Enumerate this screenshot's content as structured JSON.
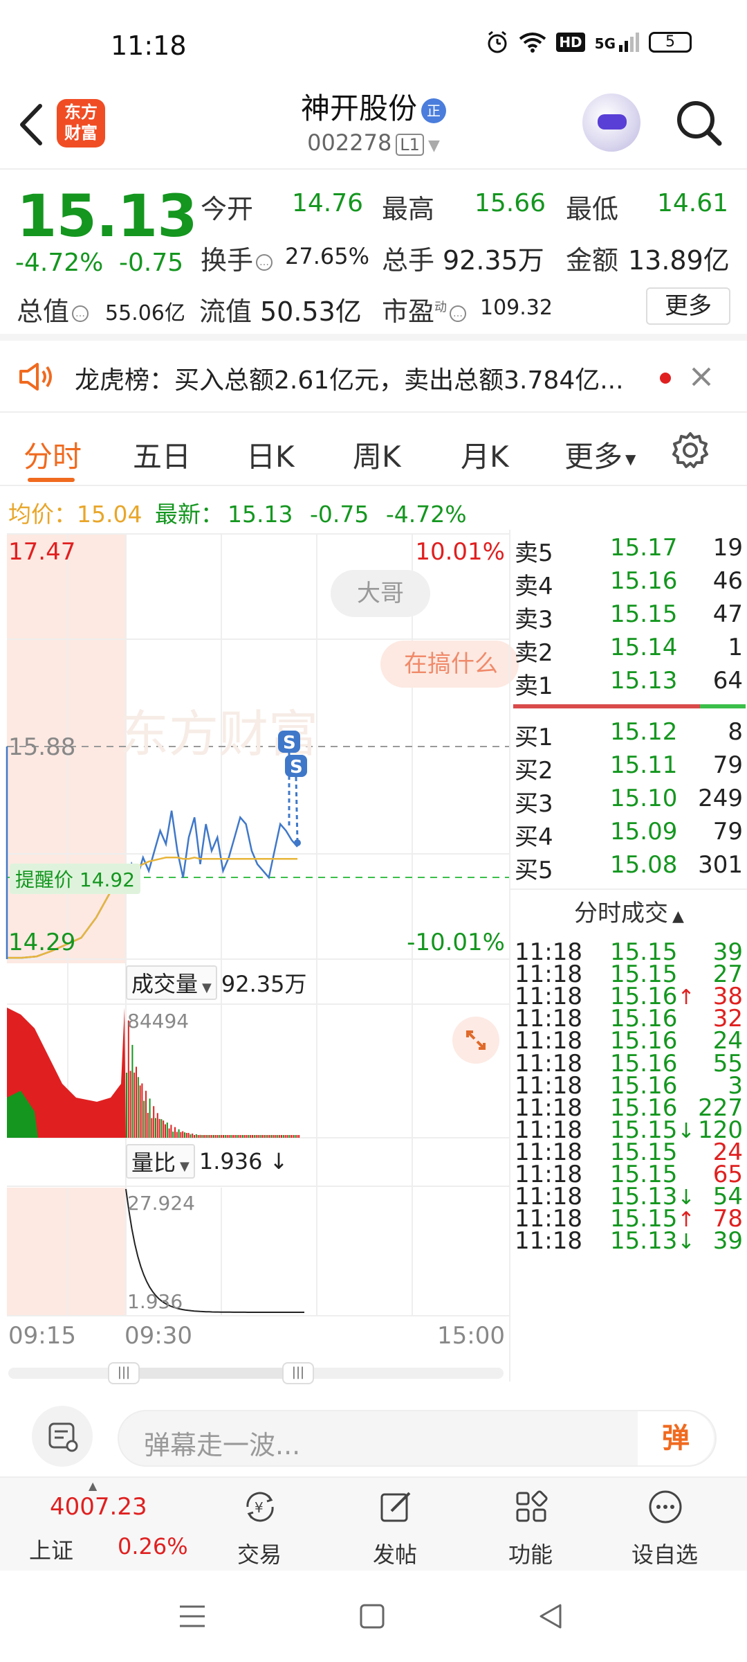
{
  "status_bar": {
    "time": "11:18",
    "hd": "HD",
    "net": "5G",
    "battery": "5"
  },
  "header": {
    "stock_name": "神开股份",
    "badge": "正",
    "stock_code": "002278",
    "level": "L1",
    "logo_line1": "东方",
    "logo_line2": "财富"
  },
  "quote": {
    "price": "15.13",
    "change_pct": "-4.72%",
    "change": "-0.75",
    "open_label": "今开",
    "open": "14.76",
    "high_label": "最高",
    "high": "15.66",
    "low_label": "最低",
    "low": "14.61",
    "turnover_label": "换手",
    "turnover": "27.65%",
    "volume_label": "总手",
    "volume": "92.35万",
    "amount_label": "金额",
    "amount": "13.89亿",
    "mktcap_label": "总值",
    "mktcap": "55.06亿",
    "float_label": "流值",
    "float_cap": "50.53亿",
    "pe_label": "市盈",
    "pe_sup": "动",
    "pe": "109.32",
    "more": "更多"
  },
  "notice": {
    "text": "龙虎榜：买入总额2.61亿元，卖出总额3.784亿..."
  },
  "tabs": [
    "分时",
    "五日",
    "日K",
    "周K",
    "月K",
    "更多"
  ],
  "avg_bar": {
    "avg_label": "均价：",
    "avg": "15.04",
    "latest_label": "最新：",
    "latest": "15.13",
    "change": "-0.75",
    "change_pct": "-4.72%"
  },
  "chart": {
    "y_top": "17.47",
    "y_top_pct": "10.01%",
    "y_mid": "15.88",
    "y_bottom": "14.29",
    "y_bottom_pct": "-10.01%",
    "alert_label": "提醒价 14.92",
    "watermark": "东方财富",
    "danmaku": [
      "大哥",
      "在搞什么"
    ],
    "s_marker": "S",
    "volume_label": "成交量",
    "volume_total": "92.35万",
    "volume_max": "84494",
    "ratio_label": "量比",
    "ratio_value": "1.936 ↓",
    "ratio_max": "27.924",
    "ratio_min": "1.936",
    "times": [
      "09:15",
      "09:30",
      "15:00"
    ],
    "colors": {
      "up": "#e02020",
      "down": "#14961f",
      "price_line": "#3f78c9",
      "avg_line": "#e8b53a"
    }
  },
  "chart_data": {
    "type": "line",
    "title": "",
    "x_range": [
      "09:15",
      "15:00"
    ],
    "ylim": [
      14.29,
      17.47
    ],
    "reference_price": 15.88,
    "alert_price": 14.92,
    "series": [
      {
        "values": [
          14.3,
          14.3,
          14.31,
          14.35,
          14.4,
          14.45,
          14.6,
          14.8,
          14.82,
          15.0,
          14.9,
          15.05,
          14.95,
          15.1,
          15.25,
          15.15,
          15.4,
          15.1,
          14.9,
          15.2,
          15.35,
          15.0,
          15.3,
          15.1,
          15.2,
          14.95,
          15.05,
          15.2,
          15.35,
          15.3,
          15.1,
          15.0,
          14.95,
          14.9,
          15.1,
          15.3,
          15.25,
          15.18,
          15.13
        ]
      },
      {
        "values": [
          14.3,
          14.3,
          14.31,
          14.35,
          14.4,
          14.45,
          14.6,
          14.8,
          14.85,
          14.95,
          14.98,
          15.0,
          15.02,
          15.03,
          15.04,
          15.05,
          15.05,
          15.05,
          15.04,
          15.04,
          15.05,
          15.04,
          15.04,
          15.04,
          15.04,
          15.04,
          15.04,
          15.04,
          15.04,
          15.04,
          15.04,
          15.04,
          15.04,
          15.04,
          15.04,
          15.04,
          15.04,
          15.04,
          15.04
        ]
      }
    ]
  },
  "order_book": {
    "asks": [
      {
        "label": "卖5",
        "price": "15.17",
        "vol": "19"
      },
      {
        "label": "卖4",
        "price": "15.16",
        "vol": "46"
      },
      {
        "label": "卖3",
        "price": "15.15",
        "vol": "47"
      },
      {
        "label": "卖2",
        "price": "15.14",
        "vol": "1"
      },
      {
        "label": "卖1",
        "price": "15.13",
        "vol": "64"
      }
    ],
    "bids": [
      {
        "label": "买1",
        "price": "15.12",
        "vol": "8"
      },
      {
        "label": "买2",
        "price": "15.11",
        "vol": "79"
      },
      {
        "label": "买3",
        "price": "15.10",
        "vol": "249"
      },
      {
        "label": "买4",
        "price": "15.09",
        "vol": "79"
      },
      {
        "label": "买5",
        "price": "15.08",
        "vol": "301"
      }
    ],
    "trades_title": "分时成交",
    "trades": [
      {
        "time": "11:18",
        "price": "15.15",
        "arrow": "",
        "vol": "39",
        "side": "down"
      },
      {
        "time": "11:18",
        "price": "15.15",
        "arrow": "",
        "vol": "27",
        "side": "down"
      },
      {
        "time": "11:18",
        "price": "15.16",
        "arrow": "↑",
        "vol": "38",
        "side": "up"
      },
      {
        "time": "11:18",
        "price": "15.16",
        "arrow": "",
        "vol": "32",
        "side": "up"
      },
      {
        "time": "11:18",
        "price": "15.16",
        "arrow": "",
        "vol": "24",
        "side": "down"
      },
      {
        "time": "11:18",
        "price": "15.16",
        "arrow": "",
        "vol": "55",
        "side": "down"
      },
      {
        "time": "11:18",
        "price": "15.16",
        "arrow": "",
        "vol": "3",
        "side": "down"
      },
      {
        "time": "11:18",
        "price": "15.16",
        "arrow": "",
        "vol": "227",
        "side": "down"
      },
      {
        "time": "11:18",
        "price": "15.15",
        "arrow": "↓",
        "vol": "120",
        "side": "down"
      },
      {
        "time": "11:18",
        "price": "15.15",
        "arrow": "",
        "vol": "24",
        "side": "up"
      },
      {
        "time": "11:18",
        "price": "15.15",
        "arrow": "",
        "vol": "65",
        "side": "up"
      },
      {
        "time": "11:18",
        "price": "15.13",
        "arrow": "↓",
        "vol": "54",
        "side": "down"
      },
      {
        "time": "11:18",
        "price": "15.15",
        "arrow": "↑",
        "vol": "78",
        "side": "up"
      },
      {
        "time": "11:18",
        "price": "15.13",
        "arrow": "↓",
        "vol": "39",
        "side": "down"
      }
    ]
  },
  "danmu": {
    "placeholder": "弹幕走一波...",
    "send": "弹"
  },
  "bottom_nav": {
    "index_value": "4007.23",
    "index_name": "上证",
    "index_pct": "0.26%",
    "items": [
      "交易",
      "发帖",
      "功能",
      "设自选"
    ]
  }
}
